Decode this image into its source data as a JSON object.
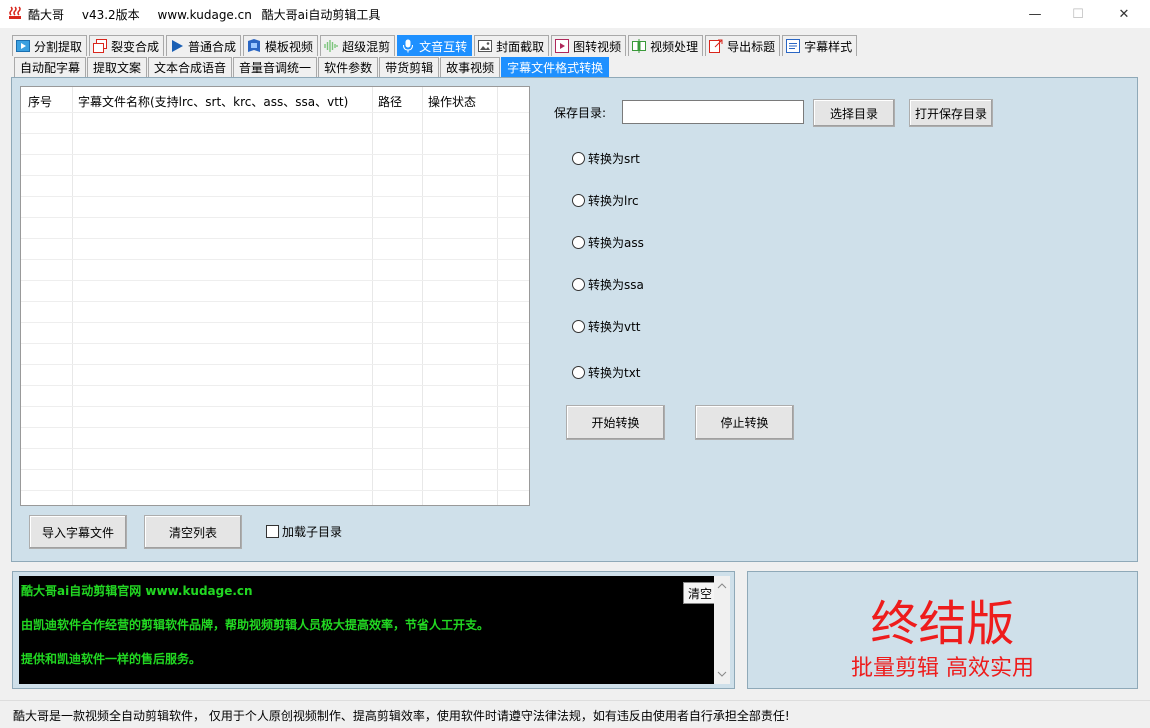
{
  "window": {
    "name": "酷大哥",
    "version": "v43.2版本",
    "site": "www.kudage.cn",
    "subtitle": "酷大哥ai自动剪辑工具",
    "minimize": "—",
    "maximize": "☐",
    "close": "✕"
  },
  "main_tabs": [
    {
      "label": "分割提取",
      "icon": "split-icon"
    },
    {
      "label": "裂变合成",
      "icon": "copy-icon"
    },
    {
      "label": "普通合成",
      "icon": "play-icon"
    },
    {
      "label": "模板视频",
      "icon": "template-icon"
    },
    {
      "label": "超级混剪",
      "icon": "waveform-icon"
    },
    {
      "label": "文音互转",
      "icon": "microphone-icon",
      "active": true
    },
    {
      "label": "封面截取",
      "icon": "image-icon"
    },
    {
      "label": "图转视频",
      "icon": "video-frame-icon"
    },
    {
      "label": "视频处理",
      "icon": "video-edit-icon"
    },
    {
      "label": "导出标题",
      "icon": "export-icon"
    },
    {
      "label": "字幕样式",
      "icon": "subtitle-icon"
    }
  ],
  "sub_tabs": [
    {
      "label": "自动配字幕"
    },
    {
      "label": "提取文案"
    },
    {
      "label": "文本合成语音"
    },
    {
      "label": "音量音调统一"
    },
    {
      "label": "软件参数"
    },
    {
      "label": "带货剪辑"
    },
    {
      "label": "故事视频"
    },
    {
      "label": "字幕文件格式转换",
      "active": true
    }
  ],
  "grid": {
    "columns": [
      "序号",
      "字幕文件名称(支持lrc、srt、krc、ass、ssa、vtt)",
      "路径",
      "操作状态"
    ]
  },
  "buttons": {
    "import": "导入字幕文件",
    "clear_list": "清空列表",
    "choose_dir": "选择目录",
    "open_dir": "打开保存目录",
    "start": "开始转换",
    "stop": "停止转换",
    "clear_log": "清空"
  },
  "include_subdirs": "加载子目录",
  "save_dir": {
    "label": "保存目录:",
    "value": ""
  },
  "formats": [
    "转换为srt",
    "转换为lrc",
    "转换为ass",
    "转换为ssa",
    "转换为vtt",
    "转换为txt"
  ],
  "log": [
    "酷大哥ai自动剪辑官网  www.kudage.cn",
    "由凯迪软件合作经营的剪辑软件品牌，帮助视频剪辑人员极大提高效率，节省人工开支。",
    "提供和凯迪软件一样的售后服务。"
  ],
  "promo": {
    "title": "终结版",
    "slogan": "批量剪辑 高效实用"
  },
  "status": "酷大哥是一款视频全自动剪辑软件， 仅用于个人原创视频制作、提高剪辑效率，使用软件时请遵守法律法规，如有违反由使用者自行承担全部责任!",
  "colors": {
    "accent": "#1e90ff",
    "panel": "#cfe0ea",
    "log_text": "#22d822",
    "promo": "#ee1c1c"
  }
}
